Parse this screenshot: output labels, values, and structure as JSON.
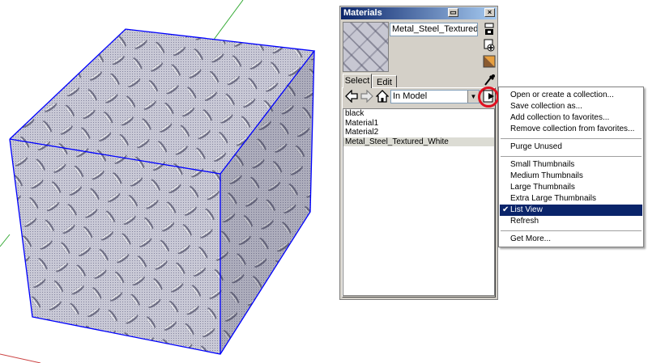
{
  "panel": {
    "title": "Materials",
    "material_name": "Metal_Steel_Textured_Wh",
    "tabs": [
      "Select",
      "Edit"
    ],
    "collection": "In Model",
    "items": [
      "black",
      "Material1",
      "Material2",
      "Metal_Steel_Textured_White"
    ],
    "selected_index": 3
  },
  "menu": {
    "groups": [
      [
        "Open or create a collection...",
        "Save collection as...",
        "Add collection to favorites...",
        "Remove collection from favorites..."
      ],
      [
        "Purge Unused"
      ],
      [
        "Small Thumbnails",
        "Medium Thumbnails",
        "Large Thumbnails",
        "Extra Large Thumbnails",
        "List View",
        "Refresh"
      ],
      [
        "Get More..."
      ]
    ],
    "checked_item": "List View",
    "highlight_color": "#0a246a"
  },
  "colors": {
    "edge": "#0000ff",
    "axis_green": "#33aa33",
    "axis_red": "#cc4444",
    "highlight_circle": "#e01020"
  }
}
